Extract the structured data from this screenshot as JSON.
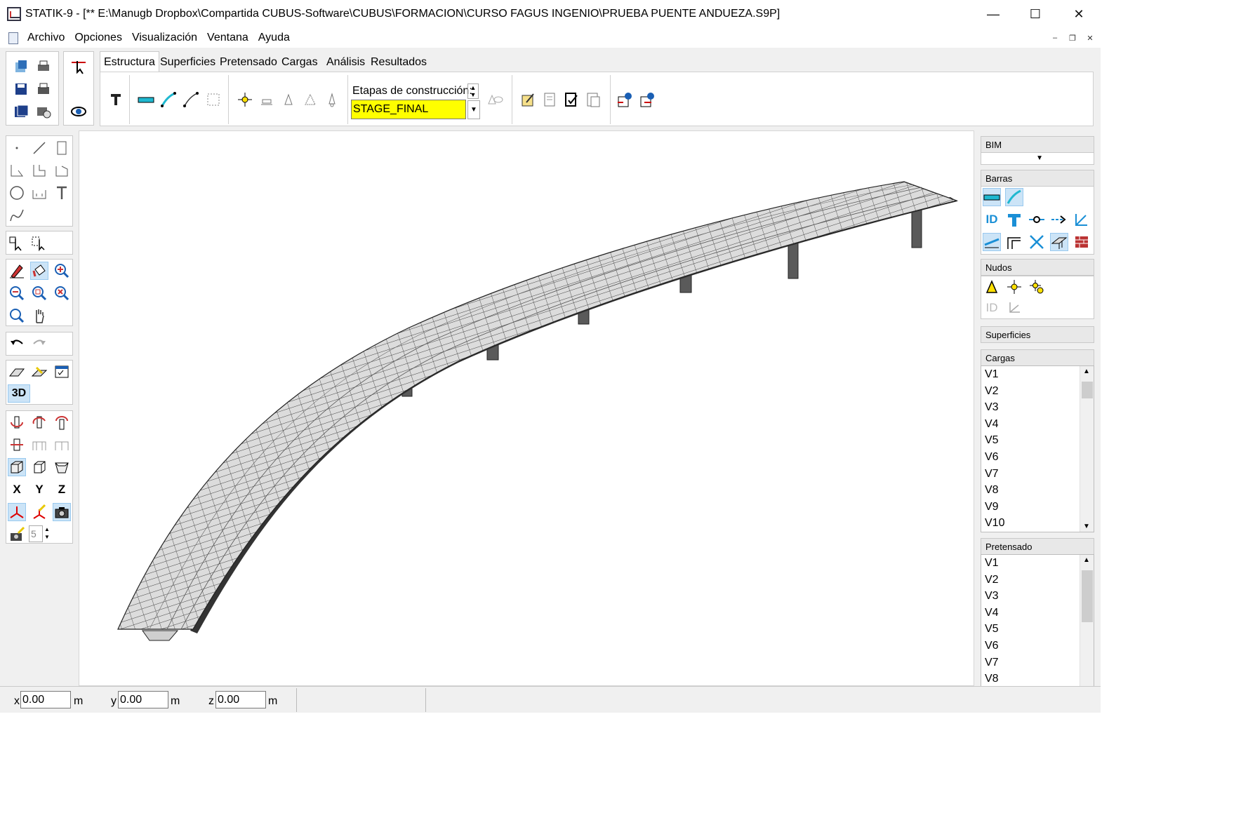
{
  "window": {
    "title": "STATIK-9 - [** E:\\Manugb Dropbox\\Compartida CUBUS-Software\\CUBUS\\FORMACION\\CURSO FAGUS INGENIO\\PRUEBA PUENTE ANDUEZA.S9P]",
    "minimize_glyph": "—",
    "maximize_glyph": "☐",
    "close_glyph": "✕"
  },
  "menu": {
    "items": [
      "Archivo",
      "Opciones",
      "Visualización",
      "Ventana",
      "Ayuda"
    ],
    "mdi_min": "–",
    "mdi_restore": "❐",
    "mdi_close": "✕"
  },
  "tabs": [
    {
      "label": "Estructura",
      "active": true
    },
    {
      "label": "Superficies"
    },
    {
      "label": "Pretensado"
    },
    {
      "label": "Cargas"
    },
    {
      "label": "Análisis"
    },
    {
      "label": "Resultados"
    }
  ],
  "ribbon": {
    "stage_label": "Etapas de construcción:",
    "stage_value": "STAGE_FINAL",
    "stage_field_color": "#ffff00"
  },
  "left_toolbar": {
    "mode_3d": "3D",
    "axis_x": "X",
    "axis_y": "Y",
    "axis_z": "Z",
    "spin_value": "5"
  },
  "right_panel": {
    "bim": {
      "header": "BIM",
      "dropdown_arrow": "▼"
    },
    "barras": {
      "header": "Barras"
    },
    "nudos": {
      "header": "Nudos"
    },
    "superficies": {
      "header": "Superficies"
    },
    "cargas": {
      "header": "Cargas",
      "items": [
        "V1",
        "V2",
        "V3",
        "V4",
        "V5",
        "V6",
        "V7",
        "V8",
        "V9",
        "V10"
      ]
    },
    "pretensado": {
      "header": "Pretensado",
      "items": [
        "V1",
        "V2",
        "V3",
        "V4",
        "V5",
        "V6",
        "V7",
        "V8"
      ]
    },
    "scroll_up": "▲",
    "scroll_down": "▼"
  },
  "status": {
    "x_label": "x",
    "x_value": "0.00",
    "y_label": "y",
    "y_value": "0.00",
    "z_label": "z",
    "z_value": "0.00",
    "unit": "m"
  },
  "colors": {
    "accent_blue": "#1a8fd6",
    "icon_cyan": "#1fb8d0",
    "yellow_highlight": "#ffff00",
    "deck_gray": "#d8d8d8",
    "pier_gray": "#555555"
  }
}
